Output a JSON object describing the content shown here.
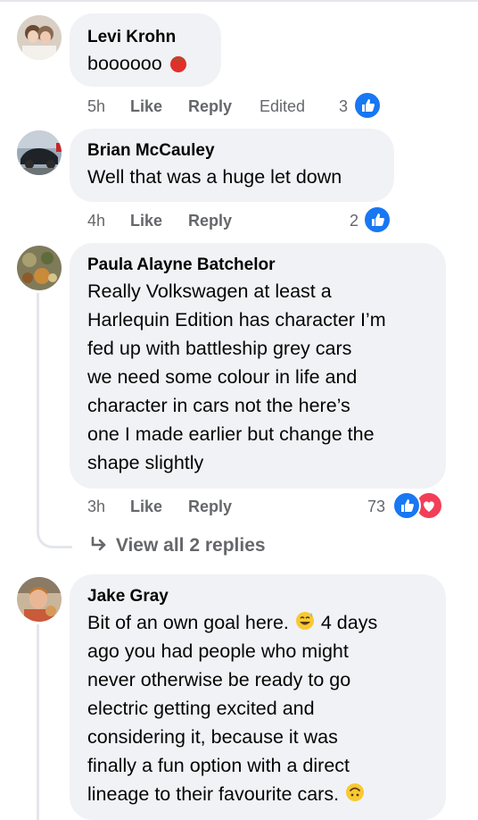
{
  "colors": {
    "bubble": "#f0f2f5",
    "meta": "#65676b",
    "like_blue": "#1877f2",
    "love_red": "#f33e58"
  },
  "comments": [
    {
      "author": "Levi Krohn",
      "text": "boooooo",
      "emoji": "tomato-emoji",
      "time": "5h",
      "like_label": "Like",
      "reply_label": "Reply",
      "edited_label": "Edited",
      "reaction_count": "3"
    },
    {
      "author": "Brian McCauley",
      "text": "Well that was a huge let down",
      "time": "4h",
      "like_label": "Like",
      "reply_label": "Reply",
      "reaction_count": "2"
    },
    {
      "author": "Paula Alayne Batchelor",
      "lines": [
        "Really Volkswagen at least a",
        "Harlequin Edition has character I’m",
        "fed up with battleship grey cars",
        "we need some colour in life and",
        "character in cars not the here’s",
        "one I made earlier but change the",
        "shape slightly"
      ],
      "time": "3h",
      "like_label": "Like",
      "reply_label": "Reply",
      "reaction_count": "73",
      "view_replies_label": "View all 2 replies"
    },
    {
      "author": "Jake Gray",
      "lines": [
        "Bit of an own goal here.",
        "4 days",
        "ago you had people who might",
        "never otherwise be ready to go",
        "electric getting excited and",
        "considering it, because it was",
        "finally a fun option with a direct",
        "lineage to their favourite cars."
      ],
      "emojis": [
        "grinning-sweat-emoji",
        "upside-down-face-emoji"
      ]
    }
  ]
}
